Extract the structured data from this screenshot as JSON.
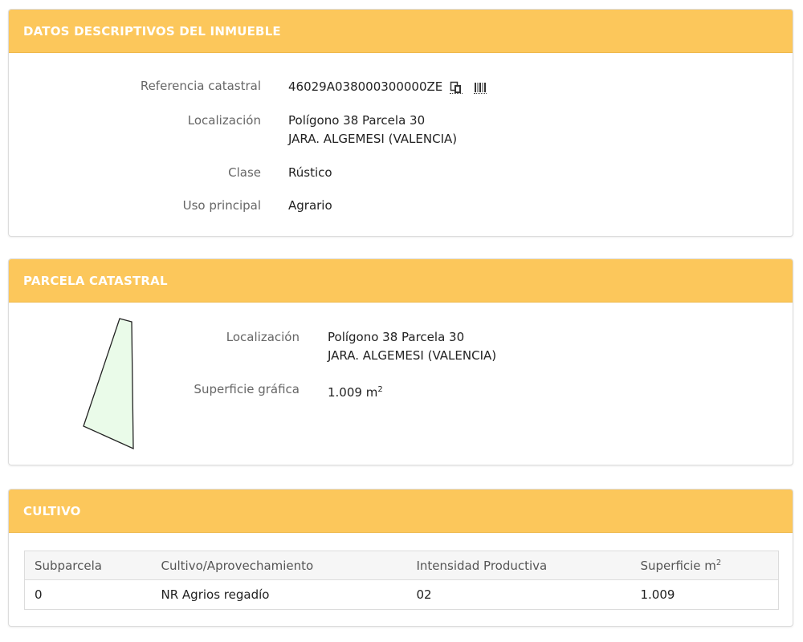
{
  "datos": {
    "title": "DATOS DESCRIPTIVOS DEL INMUEBLE",
    "referencia_label": "Referencia catastral",
    "referencia_value": "46029A038000300000ZE",
    "localizacion_label": "Localización",
    "localizacion_line1": "Polígono 38 Parcela 30",
    "localizacion_line2": "JARA. ALGEMESI (VALENCIA)",
    "clase_label": "Clase",
    "clase_value": "Rústico",
    "uso_label": "Uso principal",
    "uso_value": "Agrario",
    "icons": [
      "copy-icon",
      "barcode-icon"
    ]
  },
  "parcela": {
    "title": "PARCELA CATASTRAL",
    "localizacion_label": "Localización",
    "localizacion_line1": "Polígono 38 Parcela 30",
    "localizacion_line2": "JARA. ALGEMESI (VALENCIA)",
    "superficie_label": "Superficie gráfica",
    "superficie_value": "1.009 m",
    "superficie_unit_sup": "2",
    "shape_fill": "#eafbe9"
  },
  "cultivo": {
    "title": "CULTIVO",
    "headers": [
      "Subparcela",
      "Cultivo/Aprovechamiento",
      "Intensidad Productiva",
      "Superficie m"
    ],
    "header_sup": "2",
    "rows": [
      [
        "0",
        "NR Agrios regadío",
        "02",
        "1.009"
      ]
    ]
  },
  "colors": {
    "header_bg": "#fcc75b",
    "header_text": "#ffffff"
  }
}
